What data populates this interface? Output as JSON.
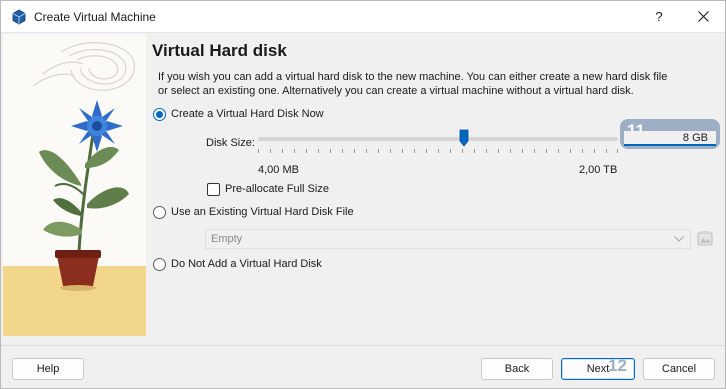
{
  "window": {
    "title": "Create Virtual Machine",
    "help_symbol": "?"
  },
  "page": {
    "heading": "Virtual Hard disk",
    "description": "If you wish you can add a virtual hard disk to the new machine. You can either create a new hard disk file or select an existing one. Alternatively you can create a virtual machine without a virtual hard disk."
  },
  "options": {
    "create_now": {
      "label": "Create a Virtual Hard Disk Now",
      "selected": true
    },
    "use_existing": {
      "label": "Use an Existing Virtual Hard Disk File",
      "selected": false
    },
    "do_not_add": {
      "label": "Do Not Add a Virtual Hard Disk",
      "selected": false
    }
  },
  "disk_size": {
    "label": "Disk Size:",
    "min_label": "4,00 MB",
    "max_label": "2,00 TB",
    "value": "8 GB",
    "badge": "11"
  },
  "preallocate": {
    "label": "Pre-allocate Full Size",
    "checked": false
  },
  "existing_file": {
    "value": "Empty"
  },
  "buttons": {
    "help": "Help",
    "back": "Back",
    "next": "Next",
    "cancel": "Cancel",
    "next_badge": "12"
  },
  "colors": {
    "accent": "#0067c0",
    "badge_bg": "#9eaec5",
    "dialog_bg": "#f0f0f0"
  },
  "icons": {
    "app": "virtualbox-icon",
    "close": "close-icon",
    "combo_arrow": "chevron-down-icon",
    "folder": "folder-browse-icon"
  }
}
